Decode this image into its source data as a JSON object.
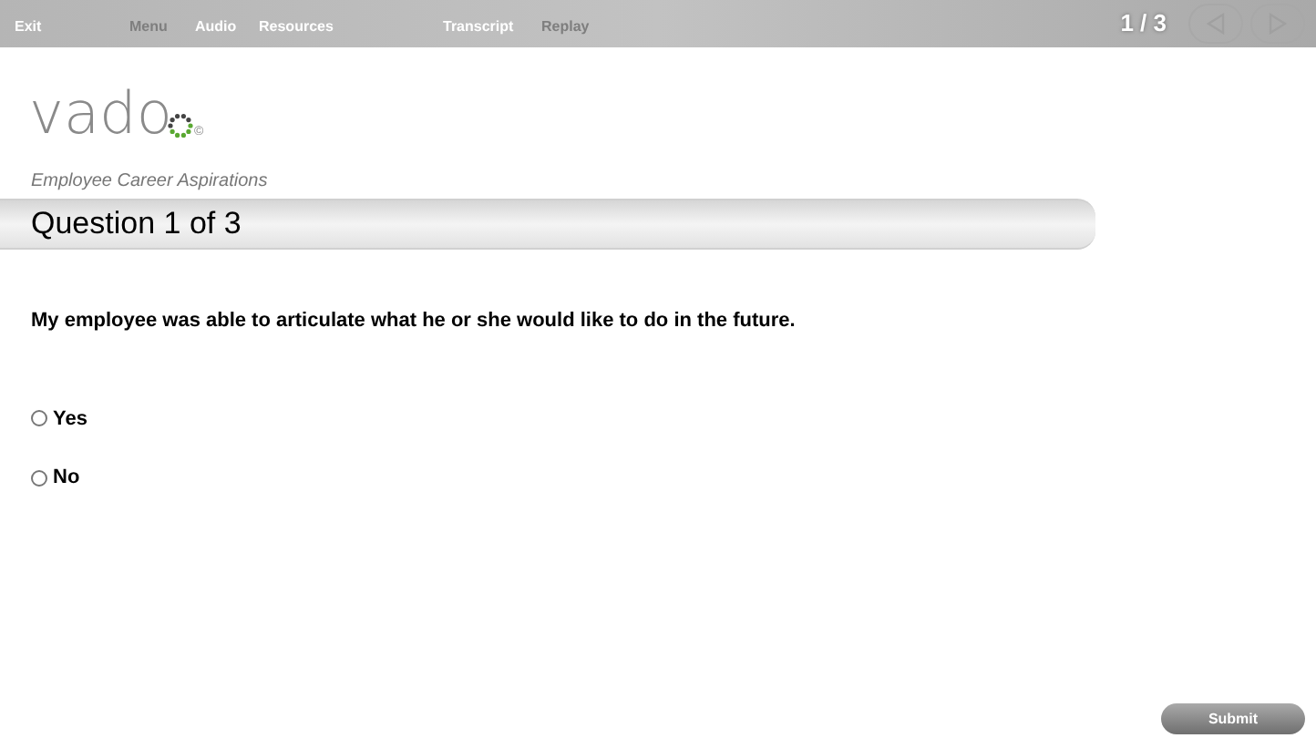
{
  "nav": [
    {
      "label": "Exit",
      "disabled": false
    },
    {
      "label": "Menu",
      "disabled": true
    },
    {
      "label": "Audio",
      "disabled": false
    },
    {
      "label": "Resources",
      "disabled": false
    },
    {
      "label": "Transcript",
      "disabled": false
    },
    {
      "label": "Replay",
      "disabled": true
    }
  ],
  "page_counter": "1 / 3",
  "logo": {
    "text": "vado",
    "mark": "©"
  },
  "course_title": "Employee Career Aspirations",
  "question_header": "Question 1 of 3",
  "question": "My employee was able to articulate what he or she would like to do in the future.",
  "options": [
    {
      "label": "Yes",
      "selected": false
    },
    {
      "label": "No",
      "selected": false
    }
  ],
  "submit": "Submit"
}
